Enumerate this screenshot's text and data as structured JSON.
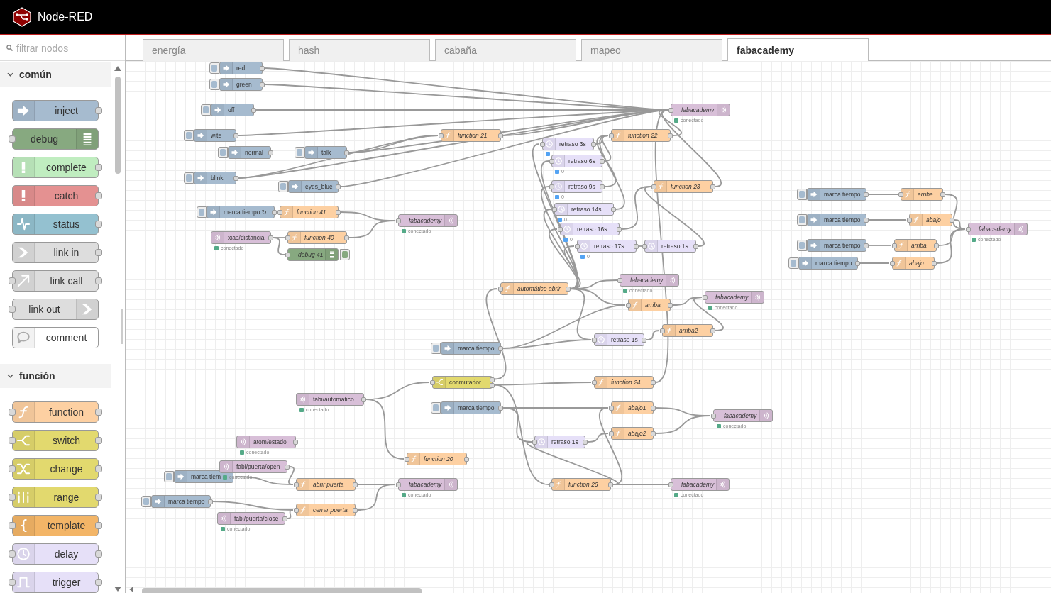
{
  "header": {
    "title": "Node-RED"
  },
  "palette": {
    "search_placeholder": "filtrar nodos",
    "categories": [
      {
        "label": "común",
        "expanded": true,
        "nodes": [
          {
            "label": "inject",
            "kind": "inject"
          },
          {
            "label": "debug",
            "kind": "debug"
          },
          {
            "label": "complete",
            "kind": "complete"
          },
          {
            "label": "catch",
            "kind": "catch"
          },
          {
            "label": "status",
            "kind": "status"
          },
          {
            "label": "link in",
            "kind": "link-in"
          },
          {
            "label": "link call",
            "kind": "link-call"
          },
          {
            "label": "link out",
            "kind": "link-out"
          },
          {
            "label": "comment",
            "kind": "comment"
          }
        ]
      },
      {
        "label": "función",
        "expanded": true,
        "nodes": [
          {
            "label": "function",
            "kind": "function"
          },
          {
            "label": "switch",
            "kind": "switch"
          },
          {
            "label": "change",
            "kind": "change"
          },
          {
            "label": "range",
            "kind": "range"
          },
          {
            "label": "template",
            "kind": "template"
          },
          {
            "label": "delay",
            "kind": "delay"
          },
          {
            "label": "trigger",
            "kind": "trigger"
          }
        ]
      }
    ]
  },
  "tabs": [
    {
      "label": "energía",
      "selected": false
    },
    {
      "label": "hash",
      "selected": false
    },
    {
      "label": "cabaña",
      "selected": false
    },
    {
      "label": "mapeo",
      "selected": false
    },
    {
      "label": "fabacademy",
      "selected": true
    }
  ],
  "flow": {
    "nodes": [
      {
        "kind": "inject",
        "label": "red"
      },
      {
        "kind": "inject",
        "label": "green"
      },
      {
        "kind": "inject",
        "label": "off"
      },
      {
        "kind": "mqtt-out",
        "label": "fabacademy",
        "status": {
          "text": "conectado",
          "color": "#55aa88"
        }
      },
      {
        "kind": "inject",
        "label": "wite"
      },
      {
        "kind": "function",
        "label": "function 21"
      },
      {
        "kind": "function",
        "label": "function 22"
      },
      {
        "kind": "inject",
        "label": "normal"
      },
      {
        "kind": "inject",
        "label": "talk"
      },
      {
        "kind": "delay",
        "label": "retraso 3s",
        "status": {
          "color": "#53a3f3"
        }
      },
      {
        "kind": "delay",
        "label": "retraso 6s",
        "status": {
          "text": "0",
          "color": "#53a3f3"
        }
      },
      {
        "kind": "inject",
        "label": "blink"
      },
      {
        "kind": "inject",
        "label": "eyes_blue"
      },
      {
        "kind": "delay",
        "label": "retraso 9s",
        "status": {
          "text": "0",
          "color": "#53a3f3"
        }
      },
      {
        "kind": "function",
        "label": "function 23"
      },
      {
        "kind": "inject",
        "label": "marca tiempo"
      },
      {
        "kind": "function",
        "label": "arriba"
      },
      {
        "kind": "inject",
        "label": "marca tiempo ↻"
      },
      {
        "kind": "function",
        "label": "function 41"
      },
      {
        "kind": "delay",
        "label": "retraso 14s",
        "status": {
          "text": "0",
          "color": "#53a3f3"
        }
      },
      {
        "kind": "mqtt-out",
        "label": "fabacademy",
        "status": {
          "text": "conectado",
          "color": "#55aa88"
        }
      },
      {
        "kind": "inject",
        "label": "marca tiempo"
      },
      {
        "kind": "function",
        "label": "abajo"
      },
      {
        "kind": "mqtt-in",
        "label": "xiao/distancia",
        "status": {
          "text": "conectado",
          "color": "#55aa88"
        }
      },
      {
        "kind": "function",
        "label": "function 40"
      },
      {
        "kind": "delay",
        "label": "retraso 16s",
        "status": {
          "text": "0",
          "color": "#53a3f3"
        }
      },
      {
        "kind": "mqtt-out",
        "label": "fabacademy",
        "status": {
          "text": "conectado",
          "color": "#55aa88"
        }
      },
      {
        "kind": "debug",
        "label": "debug 41",
        "active": true
      },
      {
        "kind": "delay",
        "label": "retraso 17s",
        "status": {
          "text": "0",
          "color": "#53a3f3"
        }
      },
      {
        "kind": "delay",
        "label": "retraso 1s"
      },
      {
        "kind": "inject",
        "label": "marca tiempo"
      },
      {
        "kind": "function",
        "label": "arriba"
      },
      {
        "kind": "inject",
        "label": "marca tiempo"
      },
      {
        "kind": "function",
        "label": "abajo"
      },
      {
        "kind": "function",
        "label": "automático abrir"
      },
      {
        "kind": "mqtt-out",
        "label": "fabacademy",
        "status": {
          "text": "conectado",
          "color": "#55aa88"
        }
      },
      {
        "kind": "function",
        "label": "arriba"
      },
      {
        "kind": "mqtt-out",
        "label": "fabacademy",
        "status": {
          "text": "conectado",
          "color": "#55aa88"
        }
      },
      {
        "kind": "function",
        "label": "arriba2"
      },
      {
        "kind": "delay",
        "label": "retraso 1s"
      },
      {
        "kind": "inject",
        "label": "marca tiempo"
      },
      {
        "kind": "switch",
        "label": "conmutador"
      },
      {
        "kind": "function",
        "label": "function 24"
      },
      {
        "kind": "mqtt-in",
        "label": "fabi/automatico",
        "status": {
          "text": "conectado",
          "color": "#55aa88"
        }
      },
      {
        "kind": "inject",
        "label": "marca tiempo"
      },
      {
        "kind": "function",
        "label": "abajo1"
      },
      {
        "kind": "mqtt-out",
        "label": "fabacademy",
        "status": {
          "text": "conectado",
          "color": "#55aa88"
        }
      },
      {
        "kind": "function",
        "label": "abajo2"
      },
      {
        "kind": "mqtt-in",
        "label": "atom/estado",
        "status": {
          "text": "conectado",
          "color": "#55aa88"
        }
      },
      {
        "kind": "delay",
        "label": "retraso 1s"
      },
      {
        "kind": "function",
        "label": "function 20"
      },
      {
        "kind": "inject",
        "label": "marca tiem"
      },
      {
        "kind": "mqtt-in",
        "label": "fabi/puerta/open",
        "status": {
          "text": "conectado",
          "color": "#55aa88"
        }
      },
      {
        "kind": "function",
        "label": "abrir puerta"
      },
      {
        "kind": "mqtt-out",
        "label": "fabacademy",
        "status": {
          "text": "conectado",
          "color": "#55aa88"
        }
      },
      {
        "kind": "function",
        "label": "function 26"
      },
      {
        "kind": "mqtt-out",
        "label": "fabacademy",
        "status": {
          "text": "conectado",
          "color": "#55aa88"
        }
      },
      {
        "kind": "inject",
        "label": "marca tiempo"
      },
      {
        "kind": "function",
        "label": "cerrar puerta"
      },
      {
        "kind": "mqtt-in",
        "label": "fabi/puerta/close",
        "status": {
          "text": "conectado",
          "color": "#55aa88"
        }
      }
    ]
  }
}
